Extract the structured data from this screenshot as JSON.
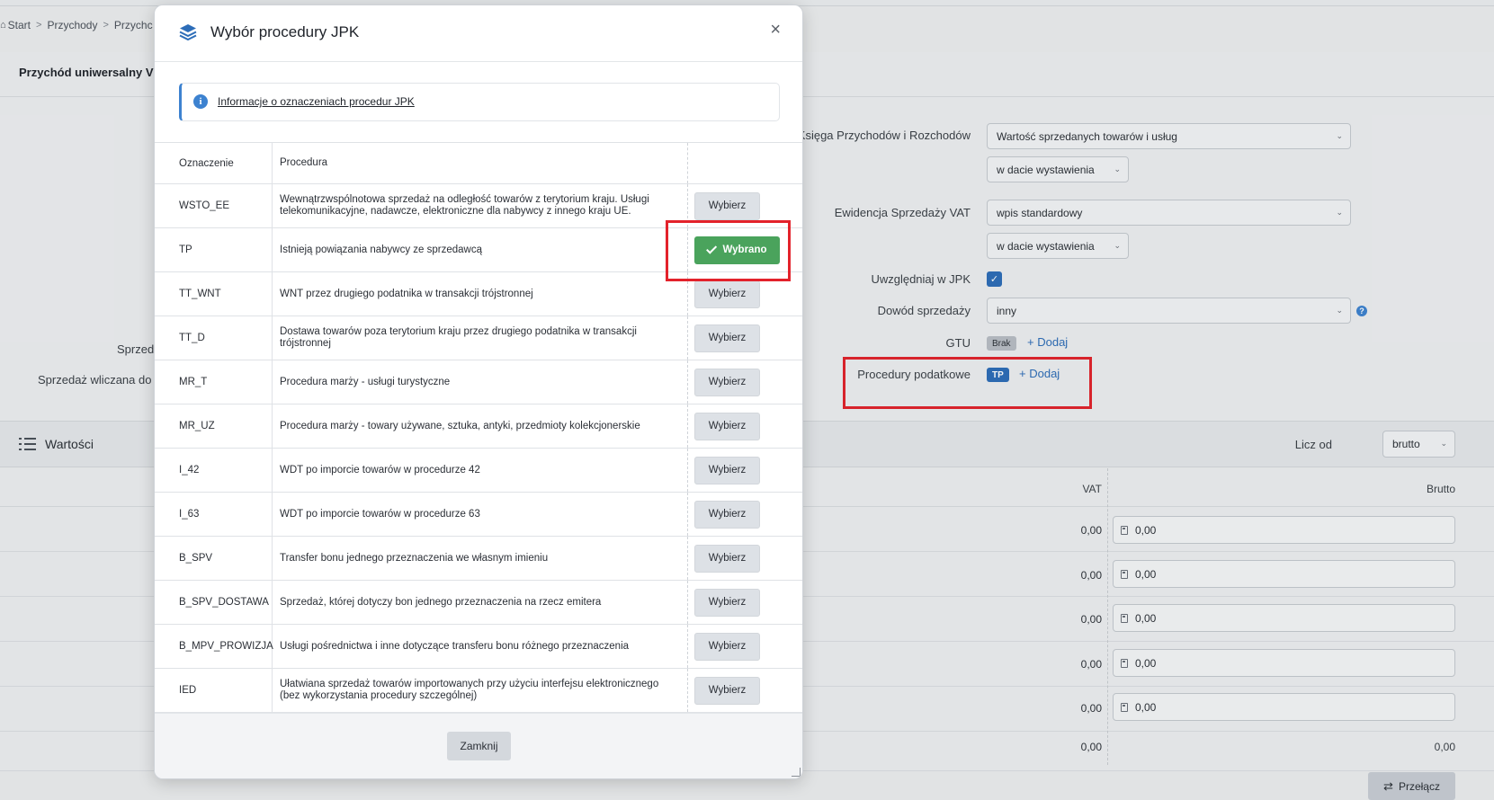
{
  "breadcrumb": {
    "start": "Start",
    "income": "Przychody",
    "income_partial": "Przychc",
    "sep": ">"
  },
  "page": {
    "title": "Przychód uniwersalny V",
    "left_label_1": "Sprzeda",
    "left_label_2": "Sprzedaż wliczana do li"
  },
  "form": {
    "kpir_label": "Księga Przychodów i Rozchodów",
    "kpir_value": "Wartość sprzedanych towarów i usług",
    "kpir_date": "w dacie wystawienia",
    "evat_label": "Ewidencja Sprzedaży VAT",
    "evat_value": "wpis standardowy",
    "evat_date": "w dacie wystawienia",
    "jpk_label": "Uwzględniaj w JPK",
    "proof_label": "Dowód sprzedaży",
    "proof_value": "inny",
    "gtu_label": "GTU",
    "gtu_badge": "Brak",
    "gtu_add": "Dodaj",
    "tax_label": "Procedury podatkowe",
    "tax_badge": "TP",
    "tax_add": "Dodaj"
  },
  "values": {
    "title": "Wartości",
    "calc_label": "Licz od",
    "calc_value": "brutto",
    "col_vat": "VAT",
    "col_gross": "Brutto",
    "rows": [
      {
        "vat": "0,00",
        "gross": "0,00"
      },
      {
        "vat": "0,00",
        "gross": "0,00"
      },
      {
        "vat": "0,00",
        "gross": "0,00"
      },
      {
        "vat": "0,00",
        "gross": "0,00"
      },
      {
        "vat": "0,00",
        "gross": "0,00"
      }
    ],
    "total_vat": "0,00",
    "total_gross": "0,00",
    "switch_label": "Przełącz"
  },
  "modal": {
    "title": "Wybór procedury JPK",
    "close_symbol": "×",
    "info_link": "Informacje o oznaczeniach procedur JPK",
    "col_code": "Oznaczenie",
    "col_desc": "Procedura",
    "choose_label": "Wybierz",
    "chosen_label": "Wybrano",
    "footer_close": "Zamknij",
    "rows": [
      {
        "code": "WSTO_EE",
        "desc": "Wewnątrzwspólnotowa sprzedaż na odległość towarów z terytorium kraju. Usługi telekomunikacyjne, nadawcze, elektroniczne dla nabywcy z innego kraju UE."
      },
      {
        "code": "TP",
        "desc": "Istnieją powiązania nabywcy ze sprzedawcą"
      },
      {
        "code": "TT_WNT",
        "desc": "WNT przez drugiego podatnika w transakcji trójstronnej"
      },
      {
        "code": "TT_D",
        "desc": "Dostawa towarów poza terytorium kraju przez drugiego podatnika w transakcji trójstronnej"
      },
      {
        "code": "MR_T",
        "desc": "Procedura marży - usługi turystyczne"
      },
      {
        "code": "MR_UZ",
        "desc": "Procedura marży - towary używane, sztuka, antyki, przedmioty kolekcjonerskie"
      },
      {
        "code": "I_42",
        "desc": "WDT po imporcie towarów w procedurze 42"
      },
      {
        "code": "I_63",
        "desc": "WDT po imporcie towarów w procedurze 63"
      },
      {
        "code": "B_SPV",
        "desc": "Transfer bonu jednego przeznaczenia we własnym imieniu"
      },
      {
        "code": "B_SPV_DOSTAWA",
        "desc": "Sprzedaż, której dotyczy bon jednego przeznaczenia na rzecz emitera"
      },
      {
        "code": "B_MPV_PROWIZJA",
        "desc": "Usługi pośrednictwa i inne dotyczące transferu bonu różnego przeznaczenia"
      },
      {
        "code": "IED",
        "desc": "Ułatwiana sprzedaż towarów importowanych przy użyciu interfejsu elektronicznego (bez wykorzystania procedury szczególnej)"
      }
    ]
  },
  "colors": {
    "accent": "#2d6db8",
    "selected": "#4aa35c",
    "highlight": "#e3222b"
  }
}
